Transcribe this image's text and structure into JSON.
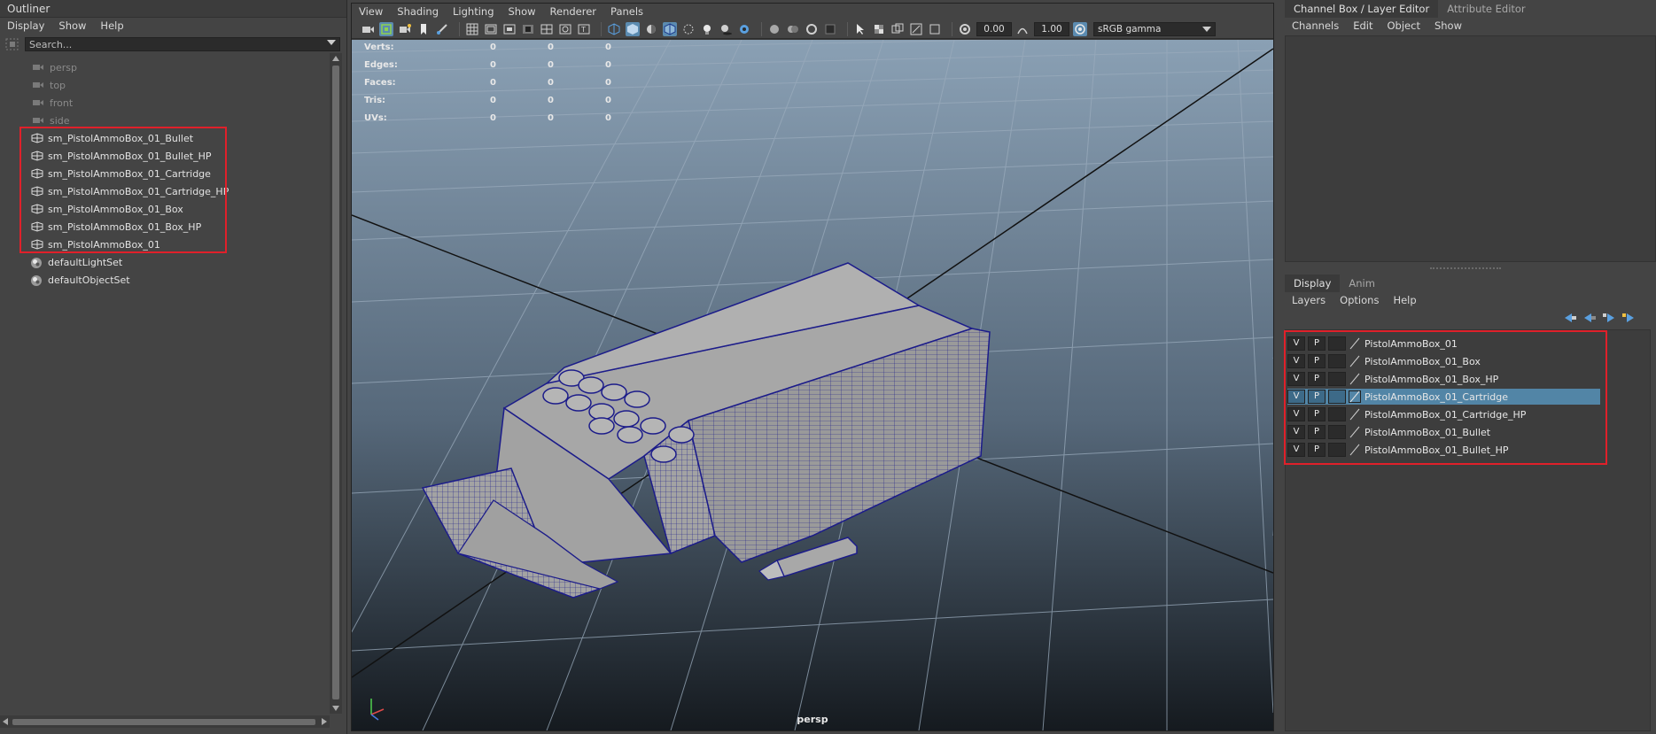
{
  "outliner": {
    "title": "Outliner",
    "menu": [
      "Display",
      "Show",
      "Help"
    ],
    "search_placeholder": "Search...",
    "items": [
      {
        "label": "persp",
        "kind": "camera"
      },
      {
        "label": "top",
        "kind": "camera"
      },
      {
        "label": "front",
        "kind": "camera"
      },
      {
        "label": "side",
        "kind": "camera"
      },
      {
        "label": "sm_PistolAmmoBox_01_Bullet",
        "kind": "mesh"
      },
      {
        "label": "sm_PistolAmmoBox_01_Bullet_HP",
        "kind": "mesh"
      },
      {
        "label": "sm_PistolAmmoBox_01_Cartridge",
        "kind": "mesh"
      },
      {
        "label": "sm_PistolAmmoBox_01_Cartridge_HP",
        "kind": "mesh"
      },
      {
        "label": "sm_PistolAmmoBox_01_Box",
        "kind": "mesh"
      },
      {
        "label": "sm_PistolAmmoBox_01_Box_HP",
        "kind": "mesh"
      },
      {
        "label": "sm_PistolAmmoBox_01",
        "kind": "mesh"
      },
      {
        "label": "defaultLightSet",
        "kind": "set"
      },
      {
        "label": "defaultObjectSet",
        "kind": "set"
      }
    ]
  },
  "viewport": {
    "menu": [
      "View",
      "Shading",
      "Lighting",
      "Show",
      "Renderer",
      "Panels"
    ],
    "exposure": "0.00",
    "gamma": "1.00",
    "color_space": "sRGB gamma",
    "hud": [
      {
        "label": "Verts:",
        "values": [
          "0",
          "0",
          "0"
        ]
      },
      {
        "label": "Edges:",
        "values": [
          "0",
          "0",
          "0"
        ]
      },
      {
        "label": "Faces:",
        "values": [
          "0",
          "0",
          "0"
        ]
      },
      {
        "label": "Tris:",
        "values": [
          "0",
          "0",
          "0"
        ]
      },
      {
        "label": "UVs:",
        "values": [
          "0",
          "0",
          "0"
        ]
      }
    ],
    "camera_label": "persp"
  },
  "right_panel": {
    "tabs": [
      "Channel Box / Layer Editor",
      "Attribute Editor"
    ],
    "channel_menu": [
      "Channels",
      "Edit",
      "Object",
      "Show"
    ],
    "layer_tabs": [
      "Display",
      "Anim"
    ],
    "layer_menu": [
      "Layers",
      "Options",
      "Help"
    ],
    "layers": [
      {
        "name": "PistolAmmoBox_01",
        "v": "V",
        "p": "P",
        "selected": false
      },
      {
        "name": "PistolAmmoBox_01_Box",
        "v": "V",
        "p": "P",
        "selected": false
      },
      {
        "name": "PistolAmmoBox_01_Box_HP",
        "v": "V",
        "p": "P",
        "selected": false
      },
      {
        "name": "PistolAmmoBox_01_Cartridge",
        "v": "V",
        "p": "P",
        "selected": true
      },
      {
        "name": "PistolAmmoBox_01_Cartridge_HP",
        "v": "V",
        "p": "P",
        "selected": false
      },
      {
        "name": "PistolAmmoBox_01_Bullet",
        "v": "V",
        "p": "P",
        "selected": false
      },
      {
        "name": "PistolAmmoBox_01_Bullet_HP",
        "v": "V",
        "p": "P",
        "selected": false
      }
    ]
  },
  "colors": {
    "highlight_box": "#e0202a",
    "selection": "#5285a6",
    "wireframe": "#1a1a8c"
  }
}
